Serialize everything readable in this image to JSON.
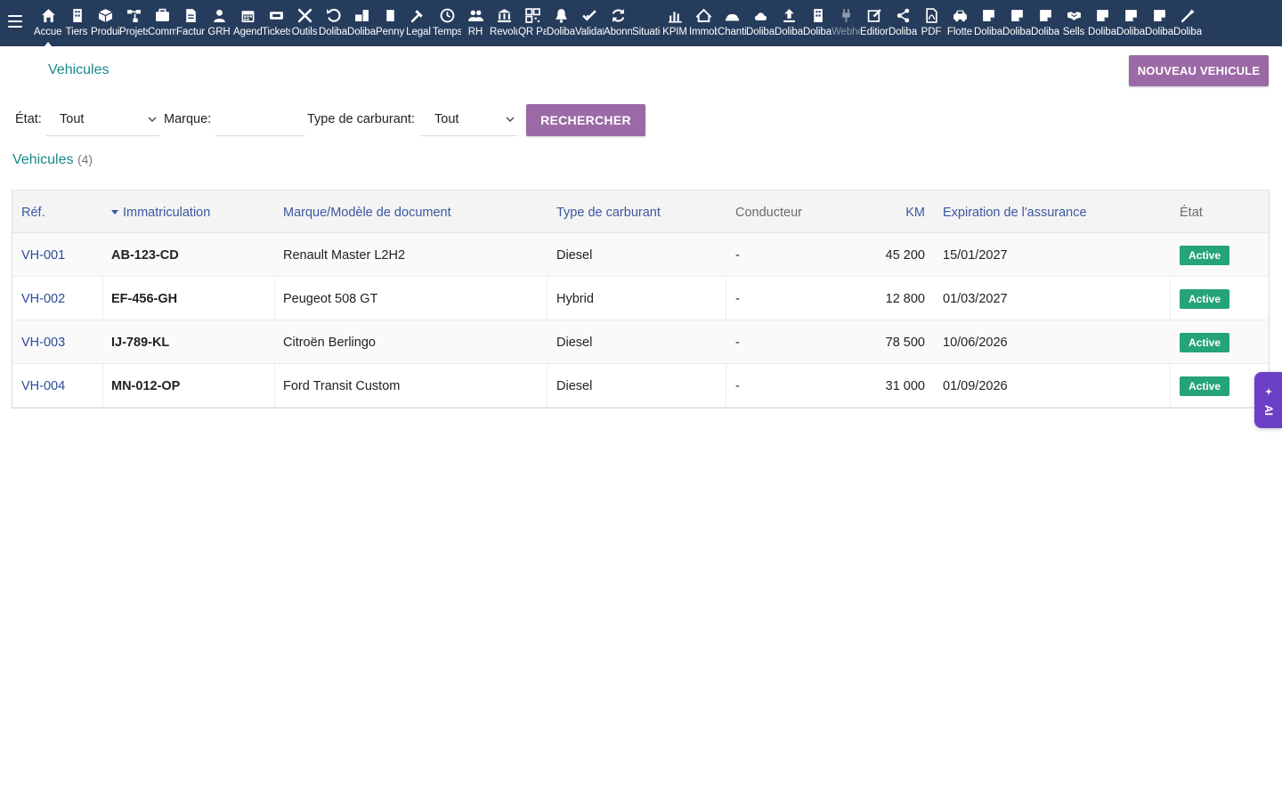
{
  "topbar": {
    "menu": [
      {
        "label": "Accueil",
        "icon": "home-icon",
        "active": true
      },
      {
        "label": "Tiers",
        "icon": "building-icon"
      },
      {
        "label": "Produits",
        "icon": "cube-icon"
      },
      {
        "label": "Projets",
        "icon": "sitemap-icon"
      },
      {
        "label": "Commerce",
        "icon": "briefcase-icon"
      },
      {
        "label": "Facturation",
        "icon": "invoice-icon"
      },
      {
        "label": "GRH",
        "icon": "user-tie-icon"
      },
      {
        "label": "Agenda",
        "icon": "calendar-icon"
      },
      {
        "label": "Tickets",
        "icon": "ticket-icon"
      },
      {
        "label": "Outils",
        "icon": "tools-icon"
      },
      {
        "label": "Dolibarr",
        "icon": "undo-icon"
      },
      {
        "label": "Dolibarr",
        "icon": "boxes-icon"
      },
      {
        "label": "Penny",
        "icon": "bookmark-icon"
      },
      {
        "label": "Legal",
        "icon": "gavel-icon"
      },
      {
        "label": "Temps",
        "icon": "clock-icon"
      },
      {
        "label": "RH",
        "icon": "users-icon"
      },
      {
        "label": "Revolut",
        "icon": "bank-icon"
      },
      {
        "label": "QR Pay",
        "icon": "qrcode-icon"
      },
      {
        "label": "Dolibarr",
        "icon": "bell-icon"
      },
      {
        "label": "Validation",
        "icon": "check-double-icon"
      },
      {
        "label": "Abonnements",
        "icon": "sync-icon"
      },
      {
        "label": "Situation",
        "icon": "blank-icon"
      },
      {
        "label": "KPIM",
        "icon": "bar-chart-icon"
      },
      {
        "label": "Immobilier",
        "icon": "house-icon"
      },
      {
        "label": "Chantier",
        "icon": "hard-hat-icon"
      },
      {
        "label": "Dolibarr",
        "icon": "cloud-icon"
      },
      {
        "label": "Dolibarr",
        "icon": "upload-icon"
      },
      {
        "label": "Dolibarr",
        "icon": "building-icon"
      },
      {
        "label": "Webhooks",
        "icon": "plug-icon",
        "dim": true
      },
      {
        "label": "Edition",
        "icon": "edit-icon"
      },
      {
        "label": "Dolibarr",
        "icon": "share-icon"
      },
      {
        "label": "PDF",
        "icon": "pdf-icon"
      },
      {
        "label": "Flotte",
        "icon": "car-icon"
      },
      {
        "label": "Dolibarr",
        "icon": "note-icon"
      },
      {
        "label": "Dolibarr",
        "icon": "note-icon"
      },
      {
        "label": "Dolibarr",
        "icon": "note-icon"
      },
      {
        "label": "Sells",
        "icon": "handshake-icon"
      },
      {
        "label": "Dolibarr",
        "icon": "note-icon"
      },
      {
        "label": "Dolibarr",
        "icon": "note-icon"
      },
      {
        "label": "Dolibarr",
        "icon": "note-icon"
      },
      {
        "label": "Dolibarr",
        "icon": "magic-icon"
      }
    ]
  },
  "page": {
    "title": "Vehicules",
    "new_button": "NOUVEAU VEHICULE"
  },
  "filters": {
    "state_label": "État:",
    "state_value": "Tout",
    "brand_label": "Marque:",
    "brand_value": "",
    "fuel_label": "Type de carburant:",
    "fuel_value": "Tout",
    "search_button": "RECHERCHER"
  },
  "list": {
    "title": "Vehicules",
    "count": "(4)",
    "columns": [
      "Réf.",
      "Immatriculation",
      "Marque/Modèle de document",
      "Type de carburant",
      "Conducteur",
      "KM",
      "Expiration de l'assurance",
      "État"
    ],
    "rows": [
      {
        "ref": "VH-001",
        "plate": "AB-123-CD",
        "model": "Renault Master L2H2",
        "fuel": "Diesel",
        "driver": "-",
        "km": "45 200",
        "insurance": "15/01/2027",
        "state": "Active"
      },
      {
        "ref": "VH-002",
        "plate": "EF-456-GH",
        "model": "Peugeot 508 GT",
        "fuel": "Hybrid",
        "driver": "-",
        "km": "12 800",
        "insurance": "01/03/2027",
        "state": "Active"
      },
      {
        "ref": "VH-003",
        "plate": "IJ-789-KL",
        "model": "Citroën Berlingo",
        "fuel": "Diesel",
        "driver": "-",
        "km": "78 500",
        "insurance": "10/06/2026",
        "state": "Active"
      },
      {
        "ref": "VH-004",
        "plate": "MN-012-OP",
        "model": "Ford Transit Custom",
        "fuel": "Diesel",
        "driver": "-",
        "km": "31 000",
        "insurance": "01/09/2026",
        "state": "Active"
      }
    ]
  },
  "ai_tab": {
    "label": "AI"
  },
  "colors": {
    "topbar": "#263c5c",
    "accent": "#9b6aa6",
    "title": "#1a8a8a",
    "link": "#2a4a9c",
    "active_badge": "#25a37a",
    "ai_tab": "#6b3fc6"
  }
}
